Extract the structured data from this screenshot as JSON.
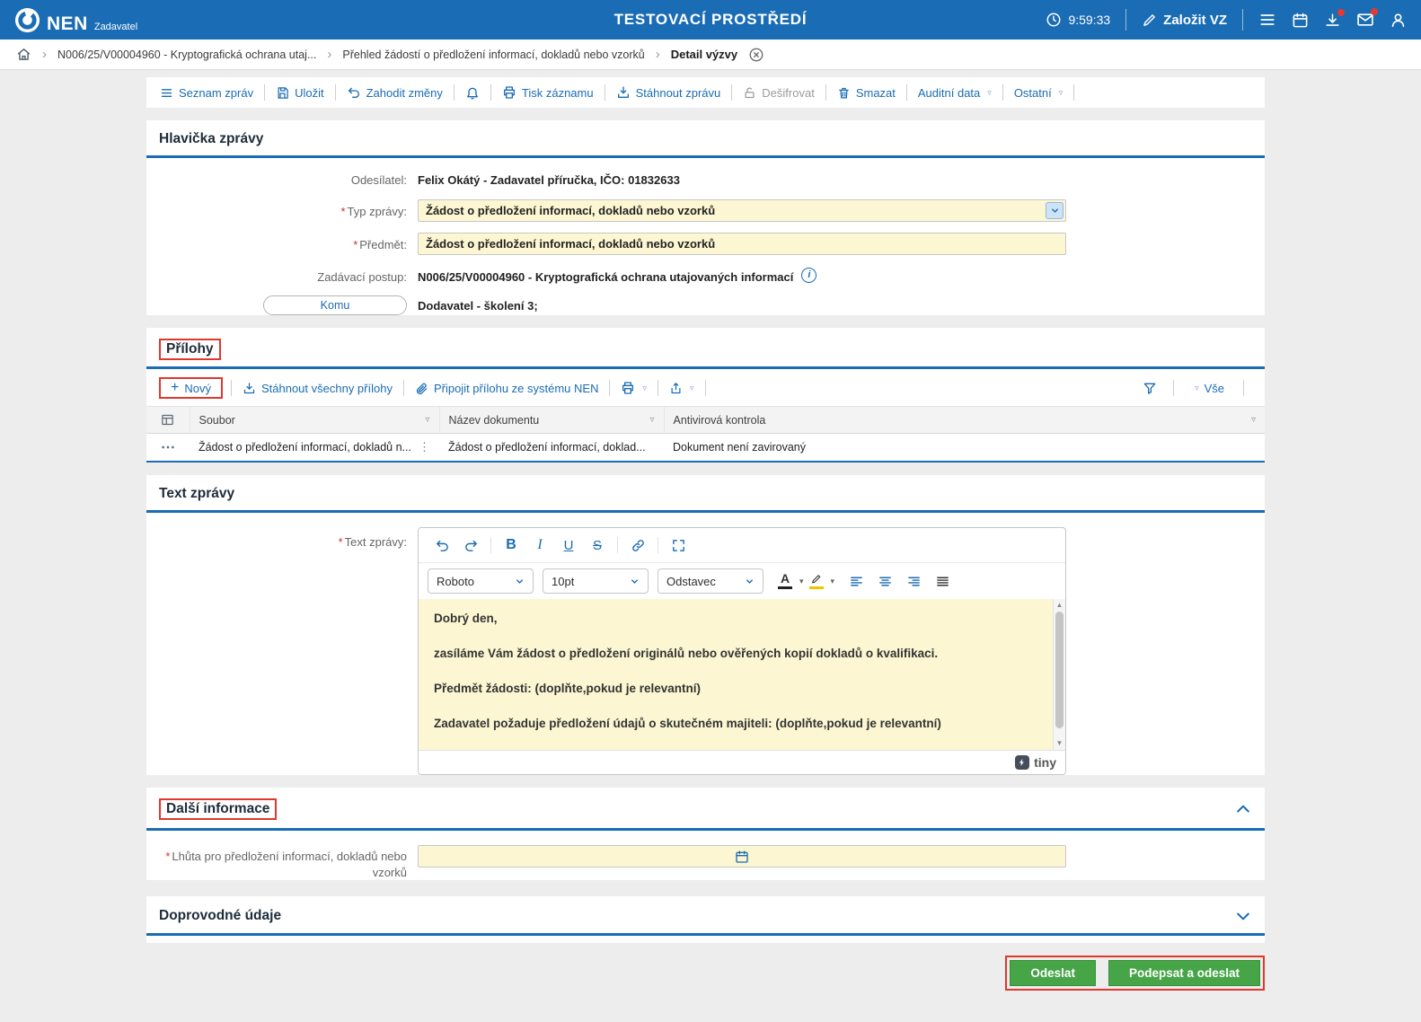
{
  "header": {
    "brand": "NEN",
    "brand_sub": "Zadavatel",
    "env_title": "TESTOVACÍ PROSTŘEDÍ",
    "time": "9:59:33",
    "create_vz_label": "Založit VZ"
  },
  "breadcrumb": {
    "items": [
      "N006/25/V00004960 - Kryptografická ochrana utaj...",
      "Přehled žádostí o předložení informací, dokladů nebo vzorků",
      "Detail výzvy"
    ]
  },
  "actions": {
    "seznam_zprav": "Seznam zpráv",
    "ulozit": "Uložit",
    "zahodit_zmeny": "Zahodit změny",
    "tisk_zaznamu": "Tisk záznamu",
    "stahnout_zpravu": "Stáhnout zprávu",
    "desifrovat": "Dešifrovat",
    "smazat": "Smazat",
    "auditni_data": "Auditní data",
    "ostatni": "Ostatní"
  },
  "hlavicka": {
    "title": "Hlavička zprávy",
    "odesilatel_label": "Odesílatel:",
    "odesilatel_value": "Felix Okátý - Zadavatel příručka, IČO: 01832633",
    "typ_zpravy_label": "Typ zprávy:",
    "typ_zpravy_value": "Žádost o předložení informací, dokladů nebo vzorků",
    "predmet_label": "Předmět:",
    "predmet_value": "Žádost o předložení informací, dokladů nebo vzorků",
    "zadavaci_postup_label": "Zadávací postup:",
    "zadavaci_postup_value": "N006/25/V00004960 - Kryptografická ochrana utajovaných informací",
    "komu_label": "Komu",
    "komu_value": "Dodavatel - školení 3;"
  },
  "prilohy": {
    "title": "Přílohy",
    "novy_label": "Nový",
    "stahnout_vsechny_label": "Stáhnout všechny přílohy",
    "pripojit_label": "Připojit přílohu ze systému NEN",
    "vse_label": "Vše",
    "columns": [
      "Soubor",
      "Název dokumentu",
      "Antivirová kontrola"
    ],
    "rows": [
      {
        "soubor": "Žádost o předložení informací, dokladů n...",
        "nazev_dokumentu": "Žádost o předložení informací, doklad...",
        "antivirova_kontrola": "Dokument není zavirovaný"
      }
    ]
  },
  "text_zpravy": {
    "title": "Text zprávy",
    "label": "Text zprávy:",
    "font_select": "Roboto",
    "size_select": "10pt",
    "block_select": "Odstavec",
    "paragraphs": [
      "Dobrý den,",
      "zasíláme Vám žádost o předložení originálů nebo ověřených kopií dokladů o kvalifikaci.",
      "Předmět žádosti: (doplňte,pokud je relevantní)",
      "Zadavatel požaduje předložení údajů o skutečném majiteli: (doplňte,pokud je relevantní)"
    ],
    "editor_brand": "tiny"
  },
  "dalsi_informace": {
    "title": "Další informace",
    "lhuta_label": "Lhůta pro předložení informací, dokladů nebo vzorků",
    "lhuta_value": ""
  },
  "doprovodne_udaje": {
    "title": "Doprovodné údaje"
  },
  "footer": {
    "odeslat_label": "Odeslat",
    "podepsat_label": "Podepsat a odeslat"
  },
  "colors": {
    "accent_blue": "#1a6cb4",
    "annotation_red": "#e0382c",
    "button_green": "#46a546",
    "required_field_yellow": "#fcf7d2"
  },
  "icons": {
    "breadcrumb_separator": "›",
    "dropdown_triangle": "▾",
    "filter_triangle": "▿",
    "vertical_dots": "⋮",
    "scroll_up": "▲",
    "scroll_down": "▼"
  }
}
